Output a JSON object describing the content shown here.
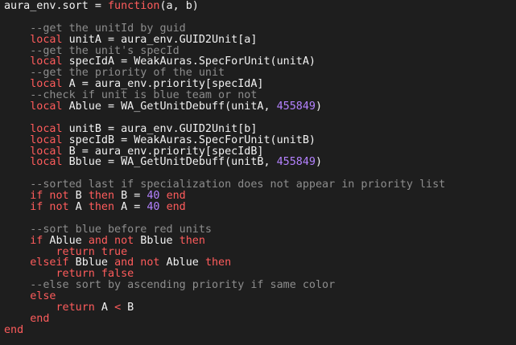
{
  "colors": {
    "background": "#1e1e1e",
    "default": "#f2f2f2",
    "keyword": "#ff5c5c",
    "comment": "#8d8d8d",
    "number": "#b482ff"
  },
  "code_lines": [
    [
      {
        "t": "default",
        "v": "aura_env.sort = "
      },
      {
        "t": "keyword",
        "v": "function"
      },
      {
        "t": "default",
        "v": "(a, b)"
      }
    ],
    [],
    [
      {
        "t": "default",
        "v": "    "
      },
      {
        "t": "comment",
        "v": "--get the unitId by guid"
      }
    ],
    [
      {
        "t": "default",
        "v": "    "
      },
      {
        "t": "keyword",
        "v": "local"
      },
      {
        "t": "default",
        "v": " unitA = aura_env.GUID2Unit[a]"
      }
    ],
    [
      {
        "t": "default",
        "v": "    "
      },
      {
        "t": "comment",
        "v": "--get the unit's specId"
      }
    ],
    [
      {
        "t": "default",
        "v": "    "
      },
      {
        "t": "keyword",
        "v": "local"
      },
      {
        "t": "default",
        "v": " specIdA = WeakAuras.SpecForUnit(unitA)"
      }
    ],
    [
      {
        "t": "default",
        "v": "    "
      },
      {
        "t": "comment",
        "v": "--get the priority of the unit"
      }
    ],
    [
      {
        "t": "default",
        "v": "    "
      },
      {
        "t": "keyword",
        "v": "local"
      },
      {
        "t": "default",
        "v": " A = aura_env.priority[specIdA]"
      }
    ],
    [
      {
        "t": "default",
        "v": "    "
      },
      {
        "t": "comment",
        "v": "--check if unit is blue team or not"
      }
    ],
    [
      {
        "t": "default",
        "v": "    "
      },
      {
        "t": "keyword",
        "v": "local"
      },
      {
        "t": "default",
        "v": " Ablue = WA_GetUnitDebuff(unitA, "
      },
      {
        "t": "number",
        "v": "455849"
      },
      {
        "t": "default",
        "v": ")"
      }
    ],
    [],
    [
      {
        "t": "default",
        "v": "    "
      },
      {
        "t": "keyword",
        "v": "local"
      },
      {
        "t": "default",
        "v": " unitB = aura_env.GUID2Unit[b]"
      }
    ],
    [
      {
        "t": "default",
        "v": "    "
      },
      {
        "t": "keyword",
        "v": "local"
      },
      {
        "t": "default",
        "v": " specIdB = WeakAuras.SpecForUnit(unitB)"
      }
    ],
    [
      {
        "t": "default",
        "v": "    "
      },
      {
        "t": "keyword",
        "v": "local"
      },
      {
        "t": "default",
        "v": " B = aura_env.priority[specIdB]"
      }
    ],
    [
      {
        "t": "default",
        "v": "    "
      },
      {
        "t": "keyword",
        "v": "local"
      },
      {
        "t": "default",
        "v": " Bblue = WA_GetUnitDebuff(unitB, "
      },
      {
        "t": "number",
        "v": "455849"
      },
      {
        "t": "default",
        "v": ")"
      }
    ],
    [],
    [
      {
        "t": "default",
        "v": "    "
      },
      {
        "t": "comment",
        "v": "--sorted last if specialization does not appear in priority list"
      }
    ],
    [
      {
        "t": "default",
        "v": "    "
      },
      {
        "t": "keyword",
        "v": "if not"
      },
      {
        "t": "default",
        "v": " B "
      },
      {
        "t": "keyword",
        "v": "then"
      },
      {
        "t": "default",
        "v": " B = "
      },
      {
        "t": "number",
        "v": "40"
      },
      {
        "t": "default",
        "v": " "
      },
      {
        "t": "keyword",
        "v": "end"
      }
    ],
    [
      {
        "t": "default",
        "v": "    "
      },
      {
        "t": "keyword",
        "v": "if not"
      },
      {
        "t": "default",
        "v": " A "
      },
      {
        "t": "keyword",
        "v": "then"
      },
      {
        "t": "default",
        "v": " A = "
      },
      {
        "t": "number",
        "v": "40"
      },
      {
        "t": "default",
        "v": " "
      },
      {
        "t": "keyword",
        "v": "end"
      }
    ],
    [],
    [
      {
        "t": "default",
        "v": "    "
      },
      {
        "t": "comment",
        "v": "--sort blue before red units"
      }
    ],
    [
      {
        "t": "default",
        "v": "    "
      },
      {
        "t": "keyword",
        "v": "if"
      },
      {
        "t": "default",
        "v": " Ablue "
      },
      {
        "t": "keyword",
        "v": "and not"
      },
      {
        "t": "default",
        "v": " Bblue "
      },
      {
        "t": "keyword",
        "v": "then"
      }
    ],
    [
      {
        "t": "default",
        "v": "        "
      },
      {
        "t": "keyword",
        "v": "return true"
      }
    ],
    [
      {
        "t": "default",
        "v": "    "
      },
      {
        "t": "keyword",
        "v": "elseif"
      },
      {
        "t": "default",
        "v": " Bblue "
      },
      {
        "t": "keyword",
        "v": "and not"
      },
      {
        "t": "default",
        "v": " Ablue "
      },
      {
        "t": "keyword",
        "v": "then"
      }
    ],
    [
      {
        "t": "default",
        "v": "        "
      },
      {
        "t": "keyword",
        "v": "return false"
      }
    ],
    [
      {
        "t": "default",
        "v": "    "
      },
      {
        "t": "comment",
        "v": "--else sort by ascending priority if same color"
      }
    ],
    [
      {
        "t": "default",
        "v": "    "
      },
      {
        "t": "keyword",
        "v": "else"
      }
    ],
    [
      {
        "t": "default",
        "v": "        "
      },
      {
        "t": "keyword",
        "v": "return"
      },
      {
        "t": "default",
        "v": " A "
      },
      {
        "t": "keyword",
        "v": "<"
      },
      {
        "t": "default",
        "v": " B"
      }
    ],
    [
      {
        "t": "default",
        "v": "    "
      },
      {
        "t": "keyword",
        "v": "end"
      }
    ],
    [
      {
        "t": "keyword",
        "v": "end"
      }
    ]
  ]
}
